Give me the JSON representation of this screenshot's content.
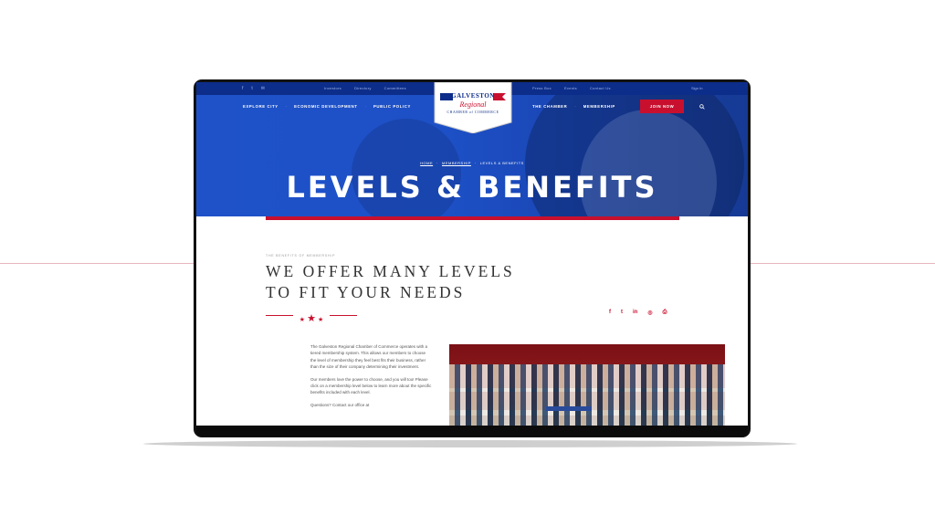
{
  "topbar": {
    "social": [
      "facebook-icon",
      "twitter-icon",
      "email-icon"
    ],
    "left_links": [
      "Investors",
      "Directory",
      "Committees"
    ],
    "right_links": [
      "Press Box",
      "Events",
      "Contact Us"
    ],
    "signin": "Sign In"
  },
  "logo": {
    "line1": "GALVESTON",
    "line2": "Regional",
    "line3": "CHAMBER of COMMERCE"
  },
  "nav": {
    "left": [
      "EXPLORE CITY",
      "ECONOMIC DEVELOPMENT",
      "PUBLIC POLICY"
    ],
    "right": [
      "THE CHAMBER",
      "MEMBERSHIP"
    ],
    "join": "JOIN NOW"
  },
  "hero": {
    "breadcrumb": [
      "HOME",
      "MEMBERSHIP",
      "LEVELS & BENEFITS"
    ],
    "title": "LEVELS & BENEFITS"
  },
  "content": {
    "eyebrow": "THE BENEFITS OF MEMBERSHIP",
    "heading_line1": "WE OFFER MANY LEVELS",
    "heading_line2": "TO FIT YOUR NEEDS",
    "share_icons": [
      "facebook-icon",
      "twitter-icon",
      "linkedin-icon",
      "instagram-icon",
      "print-icon"
    ],
    "paragraph1": "The Galveston Regional Chamber of Commerce operates with a tiered membership system. This allows our members to choose the level of membership they feel best fits their business, rather than the size of their company determining their investment.",
    "paragraph2": "Our members love the power to choose, and you will too! Please click on a membership level below to learn more about the specific benefits included with each level.",
    "paragraph3": "Questions? Contact our office at"
  },
  "colors": {
    "brand_blue": "#1f52c9",
    "brand_red": "#c8102e",
    "navy": "#0d2d8a"
  }
}
